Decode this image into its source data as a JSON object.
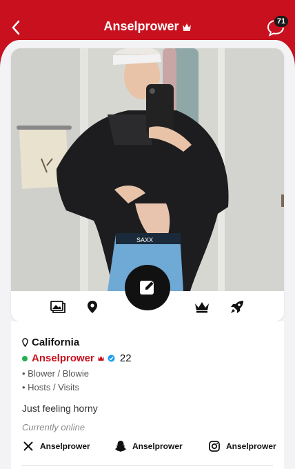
{
  "header": {
    "title": "Anselprower",
    "chat_count": "71",
    "back_icon": "chevron-left-icon",
    "title_badge_icon": "crown-icon",
    "chat_icon": "chat-bubble-icon"
  },
  "profile": {
    "location": "California",
    "name": "Anselprower",
    "age": "22",
    "tags": [
      "• Blower / Blowie",
      "• Hosts / Visits"
    ],
    "status": "Just feeling horny",
    "online_status": "Currently online"
  },
  "actions": {
    "icons": [
      "photos-icon",
      "location-pin-icon",
      "edit-icon",
      "crown-icon",
      "rocket-icon"
    ]
  },
  "socials": [
    {
      "platform": "x-icon",
      "handle": "Anselprower"
    },
    {
      "platform": "snapchat-icon",
      "handle": "Anselprower"
    },
    {
      "platform": "instagram-icon",
      "handle": "Anselprower"
    }
  ],
  "colors": {
    "brand": "#c8101e",
    "online": "#22b14c",
    "verified": "#1d9bf0"
  }
}
